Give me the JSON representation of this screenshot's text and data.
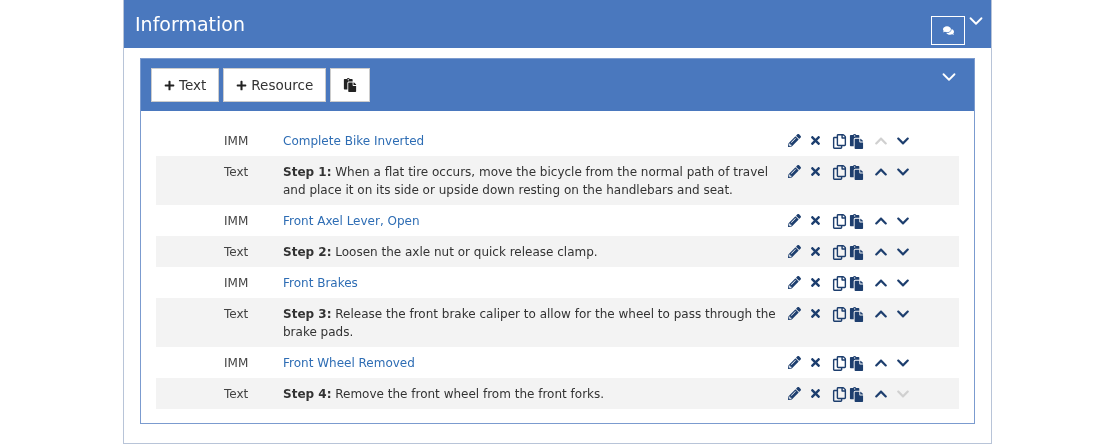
{
  "panel": {
    "title": "Information"
  },
  "toolbar": {
    "buttons": [
      {
        "kind": "add",
        "label": "Text"
      },
      {
        "kind": "add",
        "label": "Resource"
      },
      {
        "kind": "paste"
      }
    ]
  },
  "rows": [
    {
      "kind": "link",
      "type": "IMM",
      "content": "Complete Bike Inverted",
      "up_enabled": false,
      "down_enabled": true
    },
    {
      "kind": "text",
      "type": "Text",
      "content": "**Step 1:** When a flat tire occurs, move the bicycle from the normal path of travel and place it on its side or upside down resting on the handlebars and seat.",
      "up_enabled": true,
      "down_enabled": true
    },
    {
      "kind": "link",
      "type": "IMM",
      "content": "Front Axel Lever, Open",
      "up_enabled": true,
      "down_enabled": true
    },
    {
      "kind": "text",
      "type": "Text",
      "content": "**Step 2:** Loosen the axle nut or quick release clamp.",
      "up_enabled": true,
      "down_enabled": true
    },
    {
      "kind": "link",
      "type": "IMM",
      "content": "Front Brakes",
      "up_enabled": true,
      "down_enabled": true
    },
    {
      "kind": "text",
      "type": "Text",
      "content": "**Step 3:** Release the front brake caliper to allow for the wheel to pass through the brake pads.",
      "up_enabled": true,
      "down_enabled": true
    },
    {
      "kind": "link",
      "type": "IMM",
      "content": "Front Wheel Removed",
      "up_enabled": true,
      "down_enabled": true
    },
    {
      "kind": "text",
      "type": "Text",
      "content": "**Step 4:** Remove the front wheel from the front forks.",
      "up_enabled": true,
      "down_enabled": false
    }
  ]
}
